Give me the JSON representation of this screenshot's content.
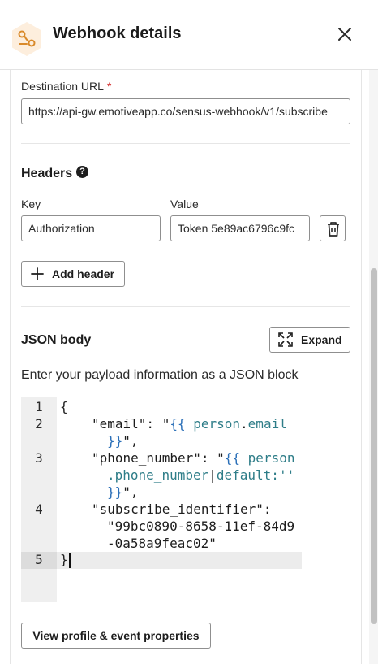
{
  "header": {
    "title": "Webhook details"
  },
  "destination": {
    "label": "Destination URL",
    "required_mark": "*",
    "url": "https://api-gw.emotiveapp.co/sensus-webhook/v1/subscribe"
  },
  "headers_section": {
    "title": "Headers",
    "help": "?",
    "key_label": "Key",
    "value_label": "Value",
    "rows": [
      {
        "key": "Authorization",
        "value": "Token 5e89ac6796c9fc"
      }
    ],
    "add_label": "Add header"
  },
  "json_body": {
    "title": "JSON body",
    "expand_label": "Expand",
    "description": "Enter your payload information as a JSON block",
    "line_numbers": [
      "1",
      "2",
      "3",
      "4",
      "5"
    ],
    "code": {
      "l1": "{",
      "l2_key": "\"email\": \"",
      "l2_tpl_open": "{{ ",
      "l2_var": "person",
      "l2_dot": ".",
      "l2_field": "email",
      "l2b_tpl_close": "}}",
      "l2b_end": "\",",
      "l3_key": "\"phone_number\": \"",
      "l3_tpl_open": "{{ ",
      "l3_var": "person",
      "l3b_dot": ".",
      "l3b_field": "phone_number",
      "l3b_pipe": "|",
      "l3b_filter": "default:''",
      "l3c_tpl_close": "}}",
      "l3c_end": "\",",
      "l4_key": "\"subscribe_identifier\":",
      "l4b_value": "\"99bc0890-8658-11ef-84d9",
      "l4c_value": "-0a58a9feac02\"",
      "l5": "}"
    }
  },
  "footer": {
    "view_props_label": "View profile & event properties"
  },
  "colors": {
    "accent_icon_bg": "#fdeedd",
    "accent_icon_fg": "#d98a2b",
    "required": "#d32f2f",
    "template_blue": "#2a6fb8"
  }
}
